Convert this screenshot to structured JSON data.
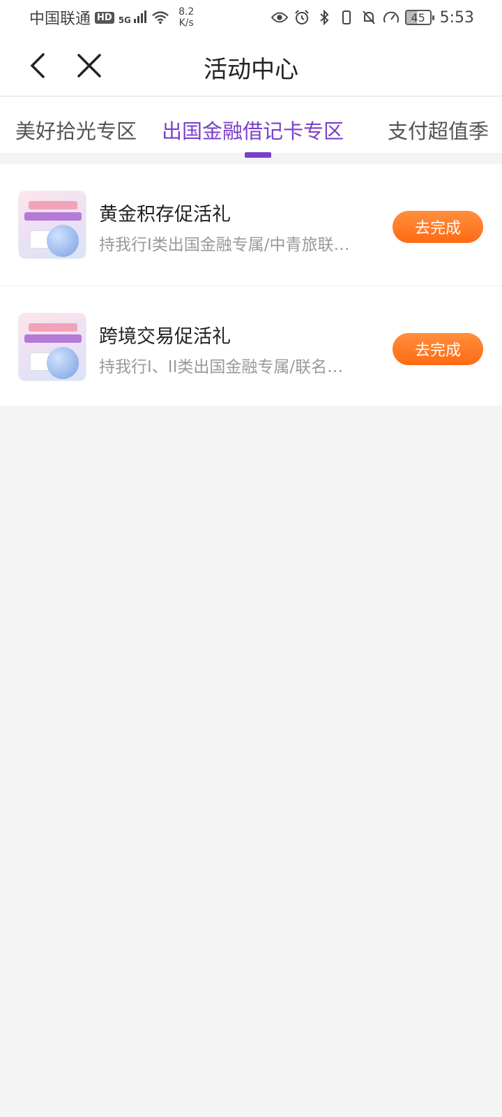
{
  "status_bar": {
    "carrier": "中国联通",
    "hd": "HD",
    "signal": "5G",
    "net_speed_value": "8.2",
    "net_speed_unit": "K/s",
    "battery": "45",
    "time": "5:53"
  },
  "header": {
    "title": "活动中心"
  },
  "tabs": [
    {
      "label": "美好拾光专区",
      "active": false
    },
    {
      "label": "出国金融借记卡专区",
      "active": true
    },
    {
      "label": "支付超值季",
      "active": false
    }
  ],
  "items": [
    {
      "title": "黄金积存促活礼",
      "desc": "持我行I类出国金融专属/中青旅联…",
      "action": "去完成"
    },
    {
      "title": "跨境交易促活礼",
      "desc": "持我行I、II类出国金融专属/联名…",
      "action": "去完成"
    }
  ],
  "colors": {
    "accent": "#7a3fc9",
    "button": "#ff7a22",
    "background": "#f4f4f4"
  }
}
